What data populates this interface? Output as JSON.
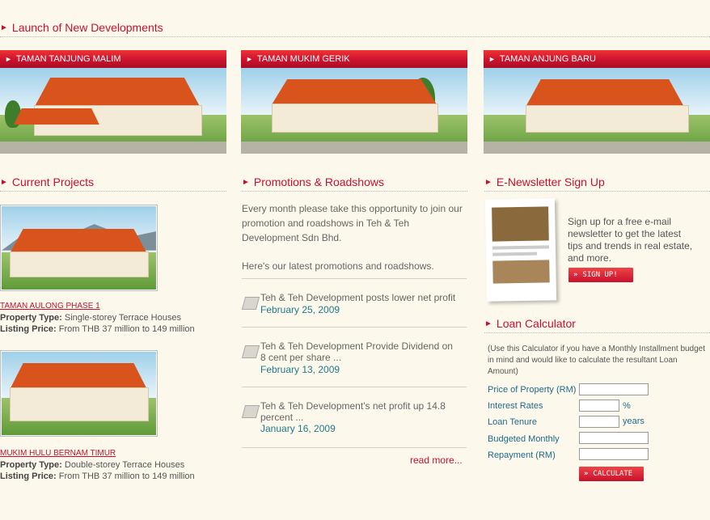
{
  "launch": {
    "title": "Launch of New Developments",
    "banners": [
      "TAMAN TANJUNG MALIM",
      "TAMAN MUKIM GERIK",
      "TAMAN ANJUNG BARU"
    ]
  },
  "current_projects": {
    "title": "Current Projects",
    "items": [
      {
        "name": "TAMAN AULONG PHASE 1",
        "type_label": "Property Type:",
        "type_value": "Single-storey Terrace Houses",
        "price_label": "Listing Price:",
        "price_value": "From THB 37 million to 149 million"
      },
      {
        "name": "MUKIM HULU BERNAM TIMUR",
        "type_label": "Property Type:",
        "type_value": "Double-storey Terrace Houses",
        "price_label": "Listing Price:",
        "price_value": "From THB 37 million to 149 million"
      }
    ]
  },
  "promotions": {
    "title": "Promotions & Roadshows",
    "intro": "Every month please take this opportunity to join our promotion and roadshows in Teh & Teh Development Sdn Bhd.",
    "intro2": "Here's our latest promotions and roadshows.",
    "news": [
      {
        "title": "Teh & Teh Development posts lower net profit",
        "date": "February 25, 2009"
      },
      {
        "title": "Teh & Teh Development Provide Dividend on 8 cent per share ...",
        "date": "February 13, 2009"
      },
      {
        "title": "Teh & Teh Development's net profit up 14.8 percent ...",
        "date": "January 16, 2009"
      }
    ],
    "read_more": "read more..."
  },
  "newsletter": {
    "title": "E-Newsletter Sign Up",
    "text": "Sign up for a free e-mail newsletter to get the latest tips and trends in real estate, and more.",
    "button": "SIGN UP!"
  },
  "loan": {
    "title": "Loan Calculator",
    "intro": "(Use this Calculator if you have a Monthly Installment budget in mind and would like to calculate the resultant Loan Amount)",
    "fields": [
      {
        "label": "Price of Property (RM)",
        "value": "",
        "suffix": ""
      },
      {
        "label": "Interest Rates",
        "value": "",
        "suffix": "%"
      },
      {
        "label": "Loan Tenure",
        "value": "",
        "suffix": "years"
      },
      {
        "label": "Budgeted Monthly",
        "value": "",
        "suffix": ""
      },
      {
        "label": "Repayment (RM)",
        "value": "",
        "suffix": ""
      }
    ],
    "button": "CALCULATE"
  },
  "colors": {
    "accent": "#c8102e",
    "link_teal": "#1e7a8a",
    "background": "#fcf8ec"
  }
}
